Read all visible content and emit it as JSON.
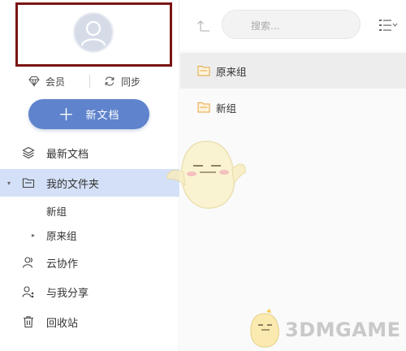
{
  "sidebar": {
    "member_label": "会员",
    "sync_label": "同步",
    "new_doc_label": "新文档",
    "nav": {
      "recent": "最新文档",
      "my_folder": "我的文件夹",
      "collab": "云协作",
      "shared": "与我分享",
      "trash": "回收站"
    },
    "folders": [
      "新组",
      "原来组"
    ]
  },
  "toolbar": {
    "search_placeholder": "搜索..."
  },
  "files": [
    {
      "name": "原来组",
      "icon": "folder-icon",
      "highlighted": true
    },
    {
      "name": "新组",
      "icon": "folder-icon",
      "highlighted": false
    }
  ],
  "watermark": {
    "text": "3DMGAME"
  },
  "colors": {
    "accent": "#5f83cc",
    "active_nav_bg": "#d3e0f7",
    "folder_icon": "#e8a341",
    "highlight_box": "#7b1414"
  }
}
